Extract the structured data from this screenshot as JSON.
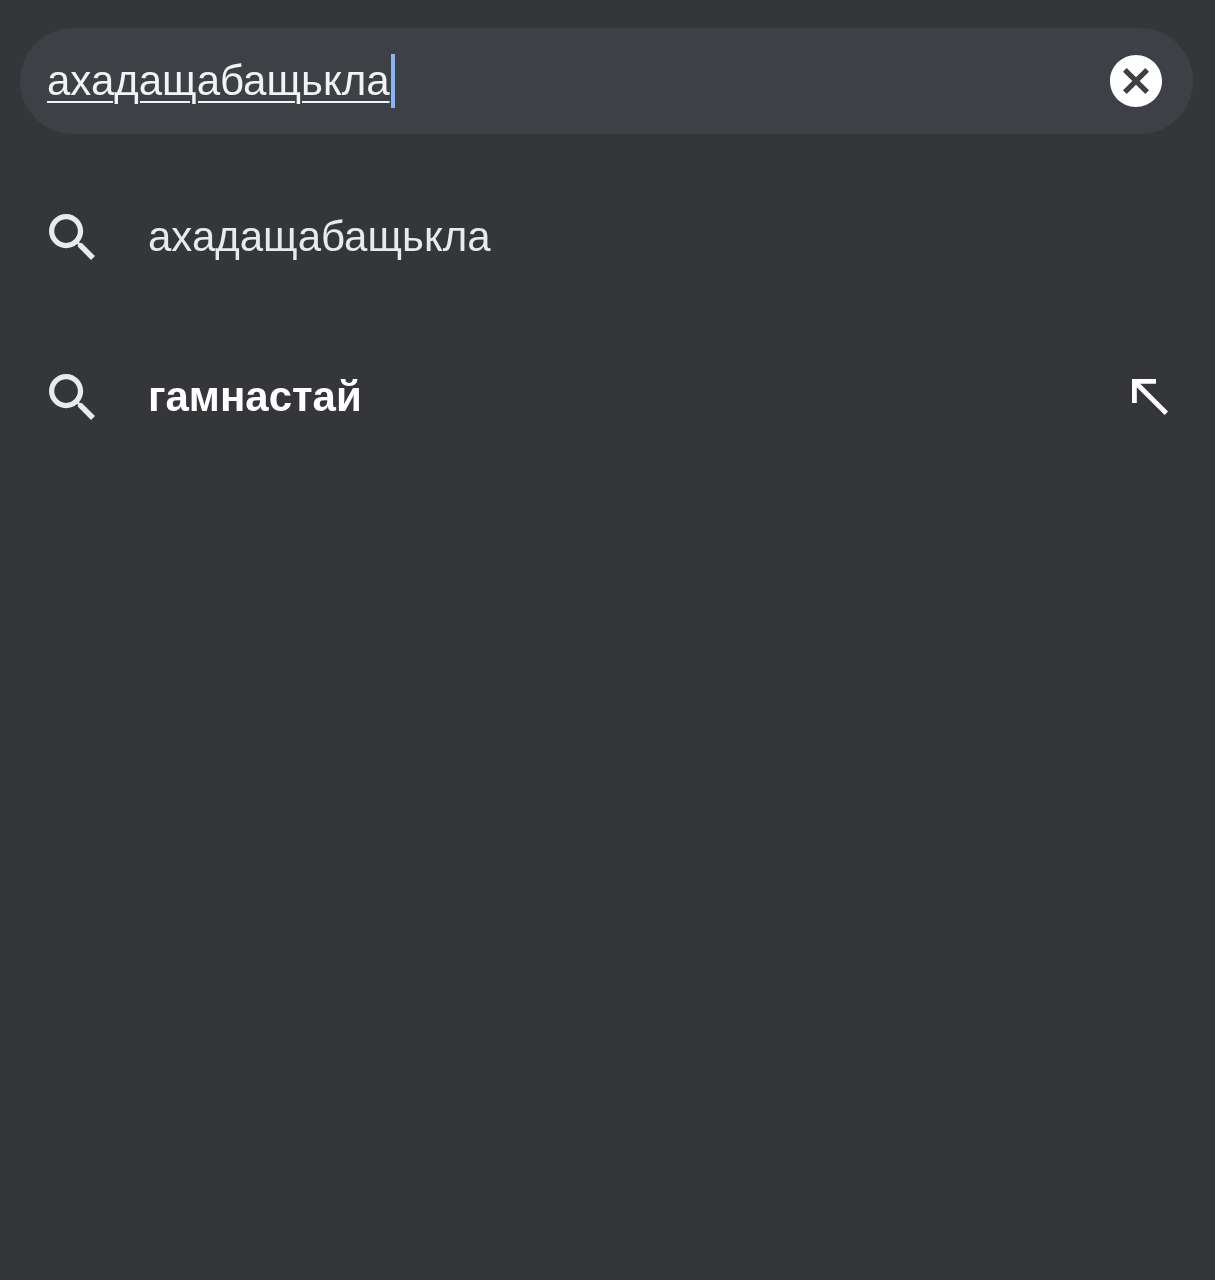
{
  "search_field": {
    "value": "ахадащабащькла",
    "composing": true,
    "focused": true
  },
  "suggestions": [
    {
      "text": "ахадащабащькла",
      "bold": false,
      "fill_arrow": false
    },
    {
      "text": "гамнастай",
      "bold": true,
      "fill_arrow": true
    }
  ]
}
